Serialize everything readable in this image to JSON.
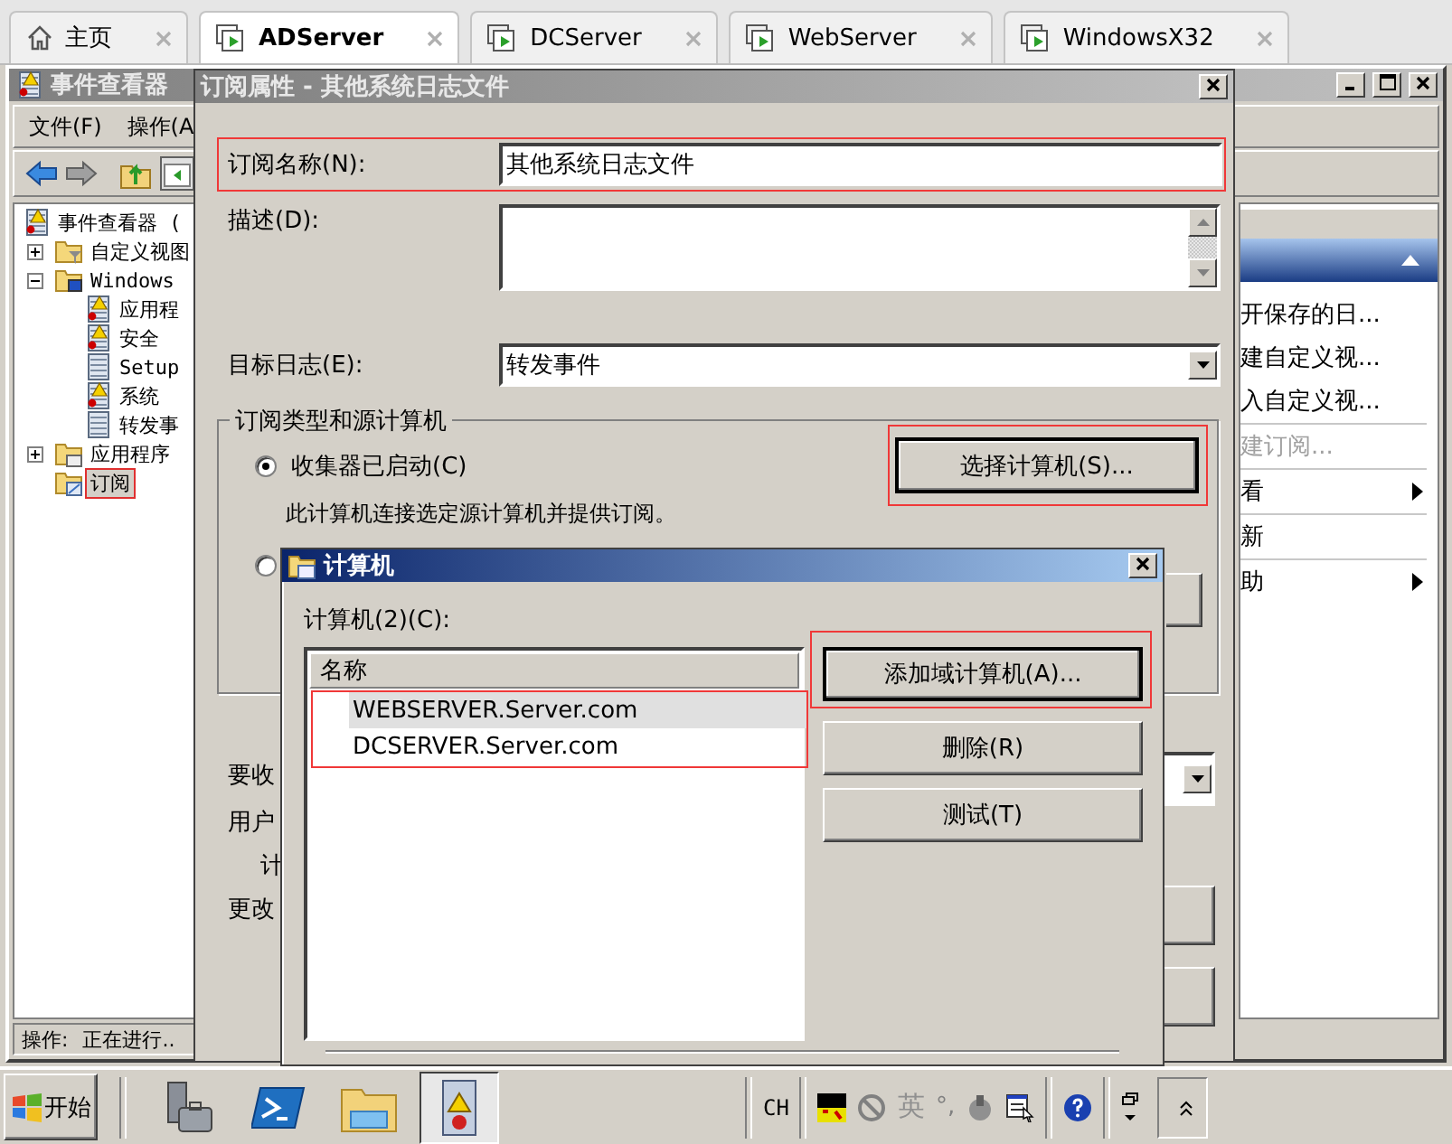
{
  "tabs": [
    {
      "label": "主页",
      "kind": "home",
      "selected": false
    },
    {
      "label": "ADServer",
      "kind": "vm",
      "selected": true
    },
    {
      "label": "DCServer",
      "kind": "vm",
      "selected": false
    },
    {
      "label": "WebServer",
      "kind": "vm",
      "selected": false
    },
    {
      "label": "WindowsX32",
      "kind": "vm",
      "selected": false
    }
  ],
  "event_viewer": {
    "title": "事件查看器",
    "menu": [
      "文件(F)",
      "操作(A"
    ],
    "tree": [
      {
        "label": "事件查看器 (",
        "kind": "log-warning",
        "selected": false,
        "children": [
          {
            "label": "自定义视图",
            "kind": "folder-filter",
            "expanded": false,
            "selected": false
          },
          {
            "label": "Windows",
            "kind": "folder-monitor",
            "expanded": true,
            "selected": false,
            "children": [
              {
                "label": "应用程",
                "kind": "log-warning",
                "selected": false
              },
              {
                "label": "安全",
                "kind": "log-warning",
                "selected": false
              },
              {
                "label": "Setup",
                "kind": "log",
                "selected": false
              },
              {
                "label": "系统",
                "kind": "log-warning",
                "selected": false
              },
              {
                "label": "转发事",
                "kind": "log",
                "selected": false
              }
            ]
          },
          {
            "label": "应用程序",
            "kind": "folder-window",
            "expanded": false,
            "selected": false
          },
          {
            "label": "订阅",
            "kind": "folder-subscription",
            "selected": true
          }
        ]
      }
    ],
    "actions": [
      {
        "label": "开保存的日...",
        "disabled": false,
        "submenu": false
      },
      {
        "label": "建自定义视...",
        "disabled": false,
        "submenu": false
      },
      {
        "label": "入自定义视...",
        "disabled": false,
        "submenu": false
      },
      {
        "label": "建订阅...",
        "disabled": true,
        "submenu": false
      },
      {
        "label": "看",
        "disabled": false,
        "submenu": true
      },
      {
        "label": "新",
        "disabled": false,
        "submenu": false
      },
      {
        "label": "助",
        "disabled": false,
        "submenu": true
      }
    ],
    "status_bar": {
      "label": "操作:",
      "value": "正在进行.."
    }
  },
  "subscription_dialog": {
    "title": "订阅属性 - 其他系统日志文件",
    "name_label": "订阅名称(N):",
    "name_value": "其他系统日志文件",
    "description_label": "描述(D):",
    "target_log_label": "目标日志(E):",
    "target_log_value": "转发事件",
    "group_title": "订阅类型和源计算机",
    "radios": [
      {
        "label": "收集器已启动(C)",
        "selected": true
      },
      {
        "selected": false
      }
    ],
    "select_button": "选择计算机(S)...",
    "collector_hint": "此计算机连接选定源计算机并提供订阅。",
    "partial_labels": [
      "要收",
      "用户",
      "计",
      "更改"
    ]
  },
  "computer_dialog": {
    "title": "计算机",
    "list_label": "计算机(2)(C):",
    "column": "名称",
    "rows": [
      {
        "name": "WEBSERVER.Server.com",
        "selected": true
      },
      {
        "name": "DCSERVER.Server.com",
        "selected": false
      }
    ],
    "buttons": [
      "添加域计算机(A)...",
      "删除(R)",
      "测试(T)"
    ]
  },
  "taskbar": {
    "start": "开始",
    "quick_launch": [
      {
        "kind": "server-manager",
        "selected": false
      },
      {
        "kind": "powershell",
        "selected": false
      },
      {
        "kind": "explorer",
        "selected": false
      },
      {
        "kind": "event-viewer",
        "selected": true
      }
    ],
    "language": "CH",
    "ime_mode": "英",
    "punctuation": "°,"
  }
}
